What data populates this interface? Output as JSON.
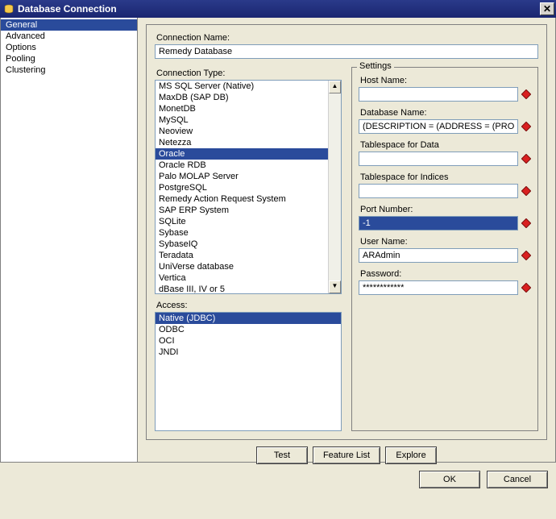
{
  "window": {
    "title": "Database Connection",
    "close": "✕"
  },
  "sidebar": {
    "items": [
      {
        "label": "General",
        "selected": true
      },
      {
        "label": "Advanced",
        "selected": false
      },
      {
        "label": "Options",
        "selected": false
      },
      {
        "label": "Pooling",
        "selected": false
      },
      {
        "label": "Clustering",
        "selected": false
      }
    ]
  },
  "main": {
    "connection_name_label": "Connection Name:",
    "connection_name_value": "Remedy Database",
    "connection_type_label": "Connection Type:",
    "connection_types": [
      "MS SQL Server (Native)",
      "MaxDB (SAP DB)",
      "MonetDB",
      "MySQL",
      "Neoview",
      "Netezza",
      "Oracle",
      "Oracle RDB",
      "Palo MOLAP Server",
      "PostgreSQL",
      "Remedy Action Request System",
      "SAP ERP System",
      "SQLite",
      "Sybase",
      "SybaseIQ",
      "Teradata",
      "UniVerse database",
      "Vertica",
      "dBase III, IV or 5"
    ],
    "connection_type_selected": "Oracle",
    "access_label": "Access:",
    "access_items": [
      "Native (JDBC)",
      "ODBC",
      "OCI",
      "JNDI"
    ],
    "access_selected": "Native (JDBC)"
  },
  "settings": {
    "legend": "Settings",
    "host_label": "Host Name:",
    "host_value": "",
    "db_label": "Database Name:",
    "db_value": "(DESCRIPTION = (ADDRESS = (PROTOCOL =",
    "ts_data_label": "Tablespace for Data",
    "ts_data_value": "",
    "ts_idx_label": "Tablespace for Indices",
    "ts_idx_value": "",
    "port_label": "Port Number:",
    "port_value": "-1",
    "user_label": "User Name:",
    "user_value": "ARAdmin",
    "password_label": "Password:",
    "password_value": "************"
  },
  "buttons": {
    "test": "Test",
    "feature_list": "Feature List",
    "explore": "Explore",
    "ok": "OK",
    "cancel": "Cancel"
  }
}
